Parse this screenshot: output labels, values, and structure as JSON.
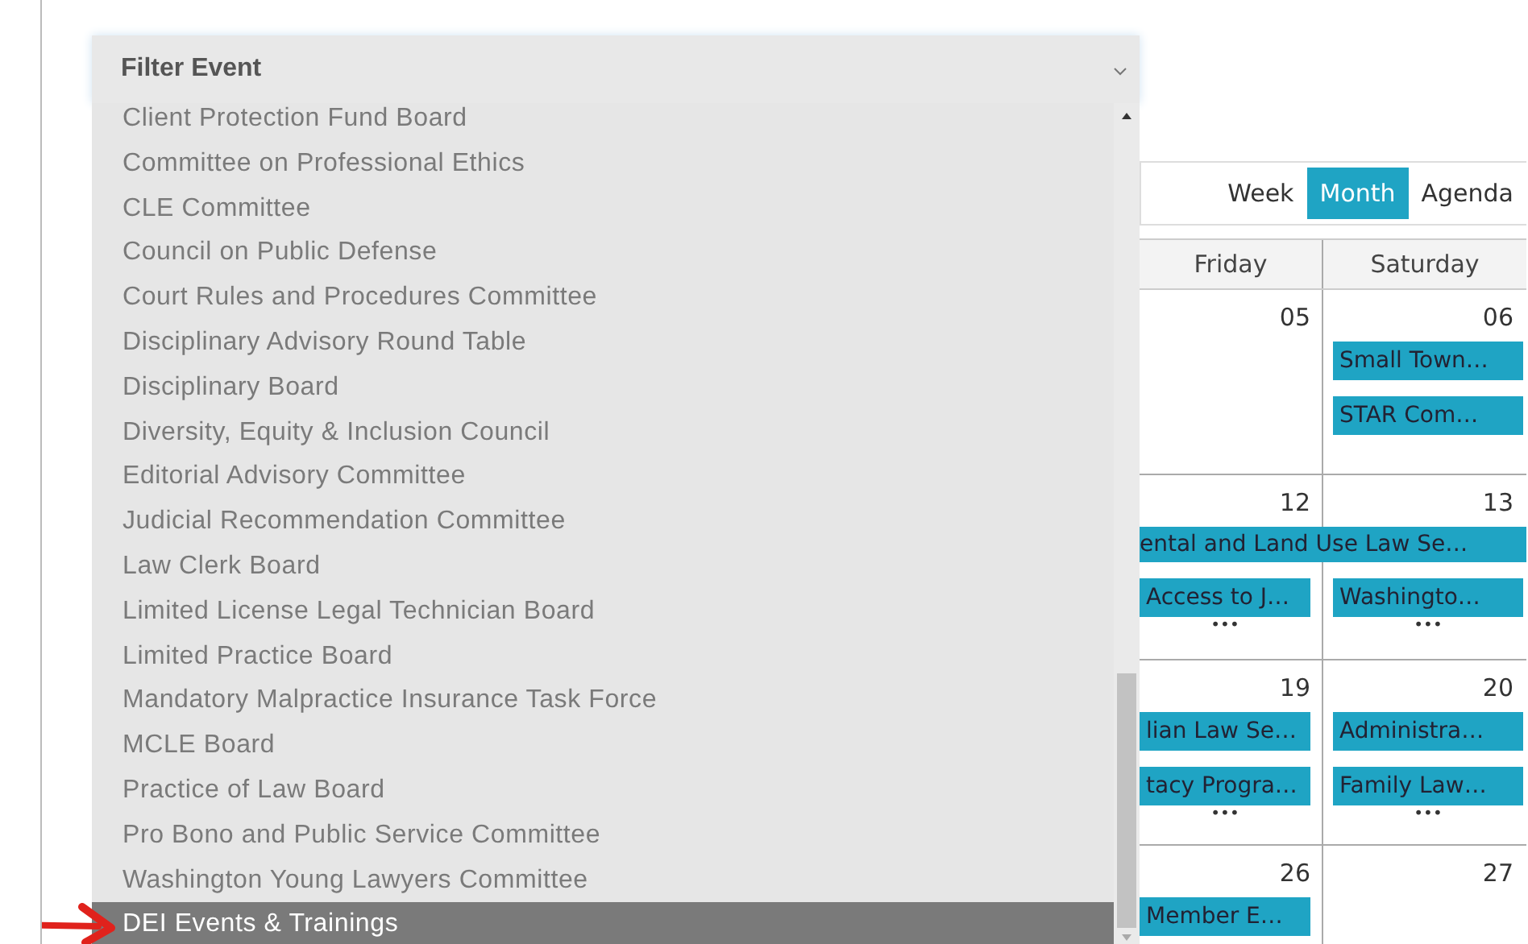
{
  "filter": {
    "label": "Filter Event",
    "options": [
      {
        "label": "Client Protection Fund Board",
        "selected": false
      },
      {
        "label": "Committee on Professional Ethics",
        "selected": false
      },
      {
        "label": "CLE Committee",
        "selected": false
      },
      {
        "label": "Council on Public Defense",
        "selected": false
      },
      {
        "label": "Court Rules and Procedures Committee",
        "selected": false
      },
      {
        "label": "Disciplinary Advisory Round Table",
        "selected": false
      },
      {
        "label": "Disciplinary Board",
        "selected": false
      },
      {
        "label": "Diversity, Equity & Inclusion Council",
        "selected": false
      },
      {
        "label": "Editorial Advisory Committee",
        "selected": false
      },
      {
        "label": "Judicial Recommendation Committee",
        "selected": false
      },
      {
        "label": "Law Clerk Board",
        "selected": false
      },
      {
        "label": "Limited License Legal Technician Board",
        "selected": false
      },
      {
        "label": "Limited Practice Board",
        "selected": false
      },
      {
        "label": "Mandatory Malpractice Insurance Task Force",
        "selected": false
      },
      {
        "label": "MCLE Board",
        "selected": false
      },
      {
        "label": "Practice of Law Board",
        "selected": false
      },
      {
        "label": "Pro Bono and Public Service Committee",
        "selected": false
      },
      {
        "label": "Washington Young Lawyers Committee",
        "selected": false
      },
      {
        "label": "DEI Events & Trainings",
        "selected": true
      }
    ]
  },
  "calendar": {
    "views": [
      {
        "label": "Week",
        "selected": false
      },
      {
        "label": "Month",
        "selected": true
      },
      {
        "label": "Agenda",
        "selected": false
      }
    ],
    "day_headers": [
      "Friday",
      "Saturday"
    ],
    "weeks": [
      {
        "dates": [
          "05",
          "06"
        ],
        "cells": [
          {},
          {
            "events": [
              "Small Town…",
              "STAR Com…"
            ]
          }
        ]
      },
      {
        "dates": [
          "12",
          "13"
        ],
        "banner": "ental and Land Use Law Se…",
        "cells": [
          {
            "events": [
              "Access to J…"
            ],
            "more": "•••"
          },
          {
            "events": [
              "Washingto…"
            ],
            "more": "•••"
          }
        ]
      },
      {
        "dates": [
          "19",
          "20"
        ],
        "cells": [
          {
            "events": [
              "lian Law Se…",
              "tacy Progra…"
            ],
            "more": "•••"
          },
          {
            "events": [
              "Administra…",
              "Family Law…"
            ],
            "more": "•••"
          }
        ]
      },
      {
        "dates": [
          "26",
          "27"
        ],
        "cells": [
          {
            "events": [
              "Member E…"
            ]
          },
          {}
        ]
      }
    ]
  }
}
